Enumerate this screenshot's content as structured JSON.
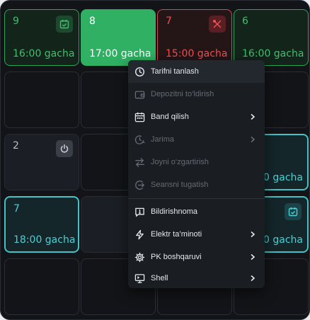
{
  "tiles": [
    {
      "number": "9",
      "until": "16:00 gacha",
      "style": "green",
      "icon": "calendar-check-icon"
    },
    {
      "number": "8",
      "until": "17:00 gacha",
      "style": "solidgreen"
    },
    {
      "number": "7",
      "until": "15:00 gacha",
      "style": "red",
      "icon": "tools-icon"
    },
    {
      "number": "6",
      "until": "16:00 gacha",
      "style": "green"
    },
    {
      "number": "2",
      "style": "dark",
      "icon": "power-icon"
    },
    {
      "until_partial": "0 gacha",
      "style": "cyan"
    },
    {
      "number": "7",
      "until": "18:00 gacha",
      "style": "cyan"
    },
    {
      "until_partial": "0 gacha",
      "style": "cyan",
      "icon": "calendar-check-icon"
    }
  ],
  "menu": {
    "items": [
      {
        "label": "Tarifni tanlash",
        "icon": "clock-icon",
        "enabled": true,
        "highlighted": true
      },
      {
        "label": "Depozitni to‘ldirish",
        "icon": "wallet-icon",
        "enabled": false
      },
      {
        "label": "Band qilish",
        "icon": "calendar-icon",
        "enabled": true,
        "submenu": true
      },
      {
        "label": "Jarima",
        "icon": "clock-minus-icon",
        "enabled": false,
        "submenu": true
      },
      {
        "label": "Joyni o‘zgartirish",
        "icon": "swap-icon",
        "enabled": false
      },
      {
        "label": "Seansni tugatish",
        "icon": "exit-icon",
        "enabled": false
      },
      {
        "label": "Bildirishnoma",
        "icon": "alert-message-icon",
        "enabled": true
      },
      {
        "label": "Elektr ta’minoti",
        "icon": "lightning-icon",
        "enabled": true,
        "submenu": true
      },
      {
        "label": "PK boshqaruvi",
        "icon": "gear-icon",
        "enabled": true,
        "submenu": true
      },
      {
        "label": "Shell",
        "icon": "monitor-icon",
        "enabled": true,
        "submenu": true
      }
    ]
  },
  "colors": {
    "green": "#3fbf6e",
    "solid_green": "#2fb062",
    "red": "#ef4f53",
    "cyan": "#4ccfd3",
    "background": "#121417",
    "menu": "#1a1d22"
  }
}
